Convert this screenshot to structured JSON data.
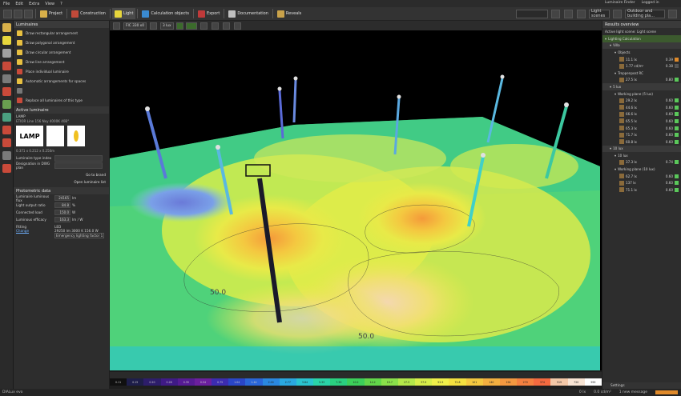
{
  "menu": [
    "File",
    "Edit",
    "Extra",
    "View",
    "?"
  ],
  "toolbar": {
    "items": [
      {
        "label": "Project",
        "color": "#d8b04a"
      },
      {
        "label": "Construction",
        "color": "#c24a3a"
      },
      {
        "label": "Light",
        "color": "#e7d63c"
      },
      {
        "label": "Calculation objects",
        "color": "#3a8ad0"
      },
      {
        "label": "Export",
        "color": "#c03a3a"
      },
      {
        "label": "Documentation",
        "color": "#c0c0c0"
      },
      {
        "label": "Reveals",
        "color": "#c9a24a"
      }
    ],
    "active_index": 2,
    "luminaire_finder": "Luminaire Finder",
    "logged_in": "Logged in",
    "light_scenes": "Light scenes",
    "scene_select": "Outdoor and building pla..."
  },
  "left_panel": {
    "header": "Luminaires",
    "tools": [
      {
        "label": "Draw rectangular arrangement",
        "enabled": true
      },
      {
        "label": "Draw polygonal arrangement",
        "enabled": true
      },
      {
        "label": "Draw circular arrangement",
        "enabled": true
      },
      {
        "label": "Draw line arrangement",
        "enabled": true
      },
      {
        "label": "Place individual luminaire",
        "enabled": true
      },
      {
        "label": "Automatic arrangements for spaces",
        "enabled": true
      },
      {
        "label": "",
        "enabled": false
      },
      {
        "label": "Replace all luminaires of this type",
        "enabled": true
      }
    ],
    "active_luminaire": {
      "section": "Active luminaire",
      "manufacturer": "LAMP",
      "name": "ETIOR Line 156 Nxy 4000K 40B°",
      "logo_text": "LAMP",
      "dims": "0.371 x 0.212 x 0.250m",
      "type_label": "Luminaire type index",
      "dwg_label": "Designation in DWG plan",
      "go_to_brand": "Go to brand",
      "open_file": "Open luminaire list"
    },
    "photometric": {
      "section": "Photometric data",
      "rows": [
        {
          "key": "Luminaire luminous flux",
          "value": "24165",
          "unit": "lm"
        },
        {
          "key": "Light output ratio",
          "value": "84.8",
          "unit": "%"
        },
        {
          "key": "Connected load",
          "value": "150.0",
          "unit": "W"
        },
        {
          "key": "Luminous efficacy",
          "value": "163.3",
          "unit": "lm / W"
        }
      ],
      "fitting_label": "Fitting",
      "change_label": "Change",
      "fitting_lines": [
        "LED",
        "29250 lm 3000 K 156.0 W",
        "Emergency lighting factor 1"
      ]
    }
  },
  "viewport": {
    "chips": [
      "FIC 330 x0",
      "3 lux"
    ],
    "contour_labels": [
      "50.0",
      "50.0"
    ]
  },
  "color_scale": {
    "unit": "lx",
    "values": [
      "0.11",
      "0.15",
      "0.20",
      "0.28",
      "0.39",
      "0.54",
      "0.75",
      "1.04",
      "1.44",
      "2.00",
      "2.77",
      "3.84",
      "5.33",
      "7.39",
      "10.2",
      "14.2",
      "19.7",
      "27.3",
      "37.9",
      "52.5",
      "72.8",
      "101",
      "140",
      "194",
      "270",
      "374",
      "519",
      "720",
      "999"
    ],
    "colors": [
      "#101010",
      "#1e1e4a",
      "#2d1d6a",
      "#3f1a86",
      "#561b94",
      "#6b1f9e",
      "#3c2cb0",
      "#2a46c8",
      "#2a66d8",
      "#2a88e0",
      "#2aa8e0",
      "#2ac4d0",
      "#2ad4a8",
      "#2ad080",
      "#3ccf5a",
      "#62d64a",
      "#8ae04a",
      "#b4e84a",
      "#d8ee4a",
      "#f0f04a",
      "#f4e040",
      "#f4c840",
      "#f4b040",
      "#f49840",
      "#f48040",
      "#f46a40",
      "#f4c8a8",
      "#f8e4d4",
      "#ffffff"
    ],
    "unit_display": "0.0 cd/m²"
  },
  "right_panel": {
    "header": "Results overview",
    "subtitle": "Active light scene: Light scene",
    "rows": [
      {
        "indent": 0,
        "kind": "hdr",
        "label": "Lighting Calculation"
      },
      {
        "indent": 1,
        "kind": "grp",
        "label": "Villa"
      },
      {
        "indent": 2,
        "kind": "sub",
        "label": "Objects"
      },
      {
        "indent": 3,
        "kind": "val",
        "label": "11.1 lx",
        "mid": "0.39",
        "flag": "o"
      },
      {
        "indent": 3,
        "kind": "val",
        "label": "1.77 cd/m²",
        "mid": "0.38",
        "flag": "d"
      },
      {
        "indent": 2,
        "kind": "sub",
        "label": "Treppenpost RC"
      },
      {
        "indent": 3,
        "kind": "val",
        "label": "27.5 lx",
        "mid": "0.80",
        "flag": "g"
      },
      {
        "indent": 1,
        "kind": "grp",
        "label": "5 lux"
      },
      {
        "indent": 2,
        "kind": "sub",
        "label": "Working plane (5 lux)"
      },
      {
        "indent": 3,
        "kind": "val",
        "label": "29.2 lx",
        "mid": "0.60",
        "flag": "g"
      },
      {
        "indent": 3,
        "kind": "val",
        "label": "44.6 lx",
        "mid": "0.60",
        "flag": "g"
      },
      {
        "indent": 3,
        "kind": "val",
        "label": "66.6 lx",
        "mid": "0.60",
        "flag": "g"
      },
      {
        "indent": 3,
        "kind": "val",
        "label": "65.5 lx",
        "mid": "0.60",
        "flag": "g"
      },
      {
        "indent": 3,
        "kind": "val",
        "label": "65.3 lx",
        "mid": "0.60",
        "flag": "g"
      },
      {
        "indent": 3,
        "kind": "val",
        "label": "71.7 lx",
        "mid": "0.60",
        "flag": "g"
      },
      {
        "indent": 3,
        "kind": "val",
        "label": "60.8 lx",
        "mid": "0.60",
        "flag": "g"
      },
      {
        "indent": 1,
        "kind": "grp",
        "label": "10 lux"
      },
      {
        "indent": 2,
        "kind": "sub",
        "label": "10 lux"
      },
      {
        "indent": 3,
        "kind": "val",
        "label": "37.3 lx",
        "mid": "0.74",
        "flag": "g"
      },
      {
        "indent": 2,
        "kind": "sub",
        "label": "Working plane (10 lux)"
      },
      {
        "indent": 3,
        "kind": "val",
        "label": "62.7 lx",
        "mid": "0.60",
        "flag": "g"
      },
      {
        "indent": 3,
        "kind": "val",
        "label": "137 lx",
        "mid": "0.60",
        "flag": "g"
      },
      {
        "indent": 3,
        "kind": "val",
        "label": "71.1 lx",
        "mid": "0.60",
        "flag": "g"
      }
    ],
    "settings": "Settings"
  },
  "status": {
    "left": "DIALux evo",
    "zoom": "0 lx",
    "luminance": "0.0 cd/m²",
    "messages": "1 new message"
  }
}
